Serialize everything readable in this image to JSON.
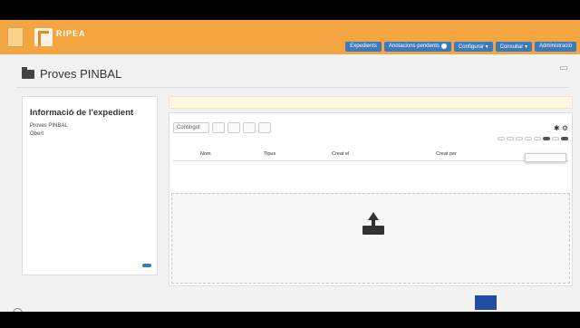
{
  "header": {
    "brand_title": "RIPEA",
    "brand_subtitle": "",
    "top_links": [
      "",
      "",
      ""
    ],
    "nav": [
      {
        "label": "Expedients"
      },
      {
        "label": "Anotacions pendents",
        "badge": ""
      },
      {
        "label": "Configurar ▾"
      },
      {
        "label": "Consultar ▾"
      },
      {
        "label": "Administració"
      }
    ]
  },
  "page": {
    "title": "Proves PINBAL",
    "right_text": "",
    "right_select": ""
  },
  "sidebar": {
    "title": "Informació de l'expedient",
    "fields": [
      {
        "key": "",
        "value": ""
      },
      {
        "key": "",
        "value": "Proves PINBAL"
      },
      {
        "key": "",
        "value": ""
      },
      {
        "key": "",
        "value": ""
      },
      {
        "key": "",
        "value": ""
      },
      {
        "key": "",
        "value": "Obert"
      },
      {
        "key": "",
        "value": ""
      }
    ],
    "button_label": ""
  },
  "alert": {
    "text": "",
    "link": ""
  },
  "tabs": [
    {
      "label": "Contingut",
      "count": ""
    },
    {
      "label": "",
      "count": ""
    },
    {
      "label": "",
      "count": ""
    },
    {
      "label": "",
      "count": ""
    },
    {
      "label": "",
      "count": ""
    }
  ],
  "toolbar": [
    "",
    "",
    "",
    "",
    "",
    "",
    "",
    ""
  ],
  "table_headers": [
    "Nom",
    "Tipus",
    "Creat el",
    "Creat per"
  ],
  "empty_text": "",
  "drop_text": "",
  "dropdown_items": [
    "",
    ""
  ],
  "footer": {
    "left_top": "",
    "left_bottom": "",
    "eu_text": "",
    "eu_right": ""
  }
}
